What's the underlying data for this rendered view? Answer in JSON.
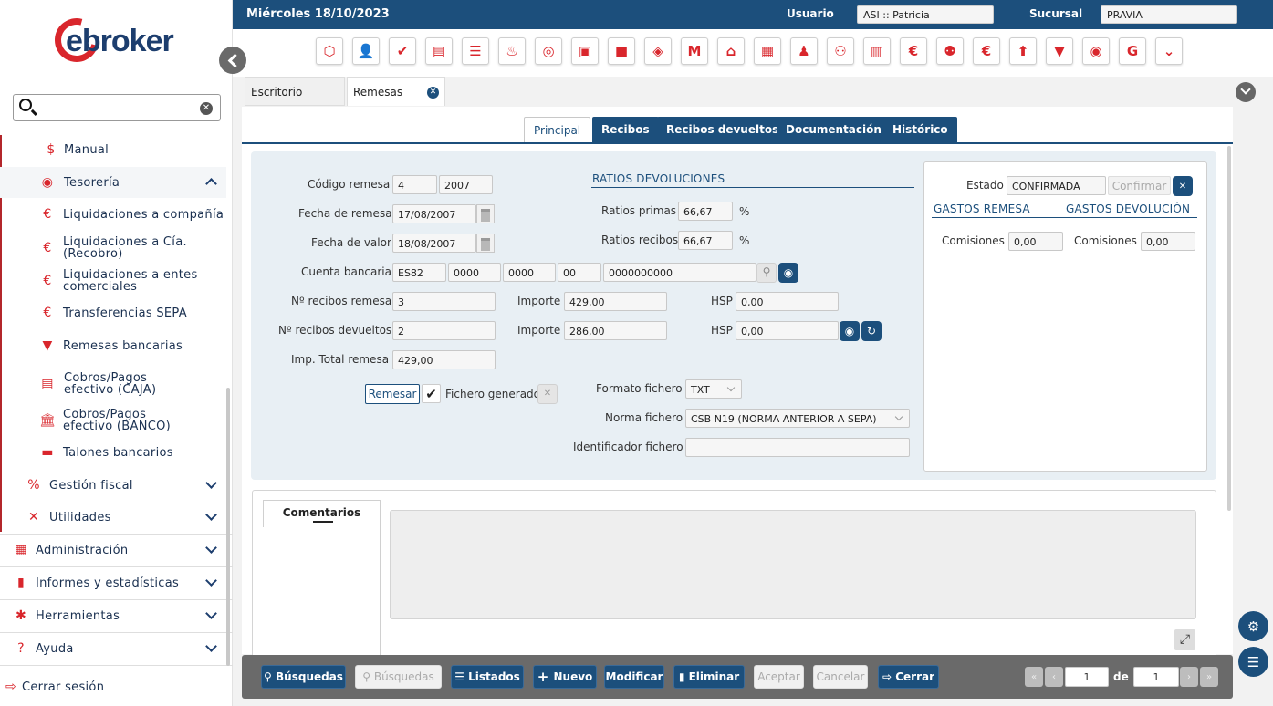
{
  "app": {
    "brand": "ebroker"
  },
  "topbar": {
    "date": "Miércoles 18/10/2023",
    "usuario_label": "Usuario",
    "usuario_value": "ASI :: Patricia",
    "sucursal_label": "Sucursal",
    "sucursal_value": "PRAVIA"
  },
  "sidebar": {
    "search_placeholder": "",
    "items": [
      {
        "label": "Manual",
        "icon": "hand-coin-icon"
      },
      {
        "label": "Tesorería",
        "icon": "coins-icon"
      },
      {
        "label": "Liquidaciones a compañía",
        "icon": "liquidation-icon"
      },
      {
        "label": "Liquidaciones a Cía. (Recobro)",
        "icon": "recobro-icon"
      },
      {
        "label": "Liquidaciones a entes comerciales",
        "icon": "entes-icon"
      },
      {
        "label": "Transferencias SEPA",
        "icon": "sepa-icon"
      },
      {
        "label": "Remesas bancarias",
        "icon": "remesa-icon"
      },
      {
        "label": "Cobros/Pagos efectivo (CAJA)",
        "icon": "cash-register-icon"
      },
      {
        "label": "Cobros/Pagos efectivo (BANCO)",
        "icon": "bank-icon"
      },
      {
        "label": "Talones bancarios",
        "icon": "cheque-icon"
      },
      {
        "label": "Gestión fiscal",
        "icon": "percent-icon"
      },
      {
        "label": "Utilidades",
        "icon": "tools-icon"
      },
      {
        "label": "Administración",
        "icon": "admin-icon"
      },
      {
        "label": "Informes y estadísticas",
        "icon": "chart-icon"
      },
      {
        "label": "Herramientas",
        "icon": "gear-icon"
      },
      {
        "label": "Ayuda",
        "icon": "help-icon"
      }
    ],
    "logout": "Cerrar sesión"
  },
  "tabs": {
    "escritorio": "Escritorio",
    "remesas": "Remesas"
  },
  "inner_tabs": [
    "Principal",
    "Recibos",
    "Recibos devueltos",
    "Documentación",
    "Histórico"
  ],
  "form": {
    "codigo_label": "Código remesa",
    "codigo_1": "4",
    "codigo_2": "2007",
    "fecha_remesa_label": "Fecha de remesa",
    "fecha_remesa": "17/08/2007",
    "fecha_valor_label": "Fecha de valor",
    "fecha_valor": "18/08/2007",
    "cuenta_label": "Cuenta bancaria",
    "cuenta": [
      "ES82",
      "0000",
      "0000",
      "00",
      "0000000000"
    ],
    "n_recibos_label": "Nº recibos remesa",
    "n_recibos": "3",
    "importe_label": "Importe",
    "importe_1": "429,00",
    "hsp_label": "HSP",
    "hsp_1": "0,00",
    "n_devueltos_label": "Nº recibos devueltos",
    "n_devueltos": "2",
    "importe_2": "286,00",
    "hsp_2": "0,00",
    "total_label": "Imp. Total remesa",
    "total": "429,00",
    "remesar_btn": "Remesar",
    "fichero_generado_label": "Fichero generado",
    "formato_label": "Formato fichero",
    "formato": "TXT",
    "norma_label": "Norma fichero",
    "norma": "CSB N19 (NORMA ANTERIOR A SEPA)",
    "identificador_label": "Identificador fichero",
    "identificador": ""
  },
  "ratios": {
    "title": "RATIOS DEVOLUCIONES",
    "primas_label": "Ratios primas",
    "primas": "66,67",
    "recibos_label": "Ratios recibos",
    "recibos": "66,67",
    "pct": "%"
  },
  "estado": {
    "label": "Estado",
    "value": "CONFIRMADA",
    "confirmar_btn": "Confirmar",
    "gastos_remesa": "GASTOS REMESA",
    "gastos_devolucion": "GASTOS DEVOLUCIÓN",
    "comisiones_label": "Comisiones",
    "comisiones_1": "0,00",
    "comisiones_2": "0,00"
  },
  "comentarios": {
    "tab": "Comentarios"
  },
  "bottom": {
    "busquedas": "Búsquedas",
    "busquedas2": "Búsquedas",
    "listados": "Listados",
    "nuevo": "Nuevo",
    "modificar": "Modificar",
    "eliminar": "Eliminar",
    "aceptar": "Aceptar",
    "cancelar": "Cancelar",
    "cerrar": "Cerrar",
    "page": "1",
    "de": "de",
    "total_pages": "1"
  },
  "colors": {
    "brand_blue": "#1c4f7c",
    "brand_red": "#d9262c"
  }
}
